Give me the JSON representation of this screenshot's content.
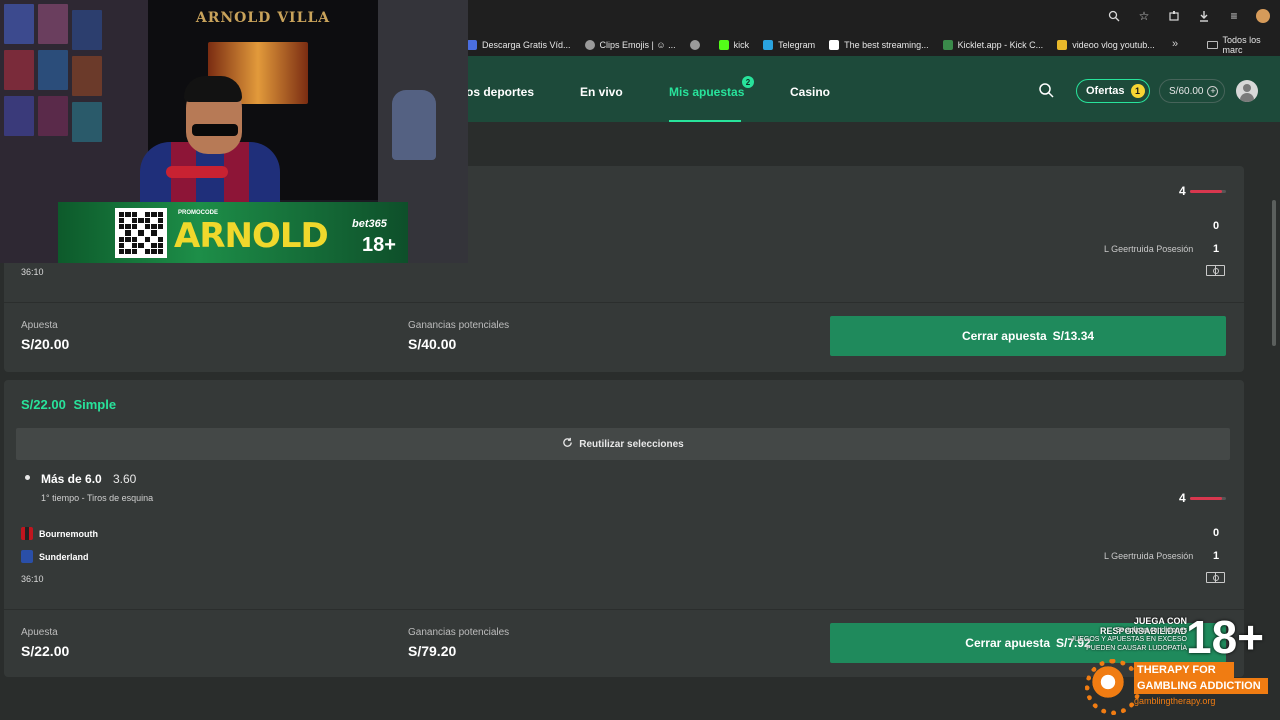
{
  "browser": {
    "bookmarks": [
      {
        "label": "Descarga Gratis Víd...",
        "icon": "page-icon"
      },
      {
        "label": "Clips Emojis | ☺ ...",
        "icon": "globe-icon"
      },
      {
        "label": "",
        "icon": "globe-icon"
      },
      {
        "label": "kick",
        "icon": "kick-icon"
      },
      {
        "label": "Telegram",
        "icon": "telegram-icon"
      },
      {
        "label": "The best streaming...",
        "icon": "diamond-icon"
      },
      {
        "label": "Kicklet.app - Kick C...",
        "icon": "kicklet-icon"
      },
      {
        "label": "videoo vlog youtub...",
        "icon": "drive-icon"
      }
    ],
    "more": "»",
    "folder": "Todos los marc"
  },
  "nav": {
    "sports": "os deportes",
    "live": "En vivo",
    "my_bets": "Mis apuestas",
    "my_bets_count": "2",
    "casino": "Casino",
    "offers": "Ofertas",
    "offers_count": "1",
    "balance": "S/60.00",
    "plus": "+"
  },
  "bet1": {
    "progress_value": "4",
    "progress_fraction": 0.9,
    "home_score": "0",
    "away_score": "1",
    "stat": "L Geertruida Posesión",
    "timer": "36:10",
    "stake_label": "Apuesta",
    "stake": "S/20.00",
    "potential_label": "Ganancias potenciales",
    "potential": "S/40.00",
    "cashout_label": "Cerrar apuesta",
    "cashout_value": "S/13.34"
  },
  "bet2": {
    "header_amount": "S/22.00",
    "header_type": "Simple",
    "reuse": "Reutilizar selecciones",
    "selection": "Más de 6.0",
    "odds": "3.60",
    "market": "1° tiempo - Tiros de esquina",
    "progress_value": "4",
    "progress_fraction": 0.9,
    "home_team": "Bournemouth",
    "away_team": "Sunderland",
    "home_score": "0",
    "away_score": "1",
    "stat": "L Geertruida Posesión",
    "timer": "36:10",
    "stake_label": "Apuesta",
    "stake": "S/22.00",
    "potential_label": "Ganancias potenciales",
    "potential": "S/79.20",
    "cashout_label": "Cerrar apuesta",
    "cashout_value": "S/7.92"
  },
  "overlay": {
    "streamer_banner": "ARNOLD VILLA",
    "promocode_label": "PROMOCODE",
    "promocode": "ARNOLD",
    "brand": "bet365",
    "age": "18+",
    "resp_title": "JUEGA CON RESPONSABILIDAD",
    "resp_line1": "Se aplican condiciones",
    "resp_line2": "JUEGOS Y APUESTAS EN EXCESO",
    "resp_line3": "PUEDEN CAUSAR LUDOPATÍA",
    "resp_age": "18+",
    "therapy1": "THERAPY FOR",
    "therapy2": "GAMBLING ADDICTION",
    "therapy_site": "gamblingtherapy.org"
  },
  "colors": {
    "accent": "#28e39b",
    "nav_bg": "#1d4a3a",
    "cashout": "#1f8a5c",
    "progress": "#d8374e"
  }
}
